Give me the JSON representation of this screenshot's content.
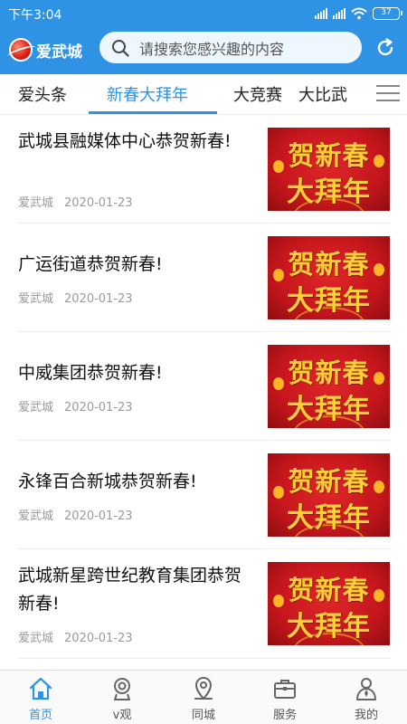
{
  "status": {
    "time": "下午3:04",
    "battery": "37"
  },
  "app": {
    "logo_text": "爱武城"
  },
  "search": {
    "placeholder": "请搜索您感兴趣的内容"
  },
  "tabs": [
    {
      "label": "爱头条"
    },
    {
      "label": "新春大拜年"
    },
    {
      "label": "大竞赛"
    },
    {
      "label": "大比武"
    }
  ],
  "feed": {
    "items": [
      {
        "title": "武城县融媒体中心恭贺新春!",
        "source": "爱武城",
        "date": "2020-01-23",
        "thumb_line1": "贺新春",
        "thumb_line2": "大拜年"
      },
      {
        "title": "广运街道恭贺新春!",
        "source": "爱武城",
        "date": "2020-01-23",
        "thumb_line1": "贺新春",
        "thumb_line2": "大拜年"
      },
      {
        "title": "中威集团恭贺新春!",
        "source": "爱武城",
        "date": "2020-01-23",
        "thumb_line1": "贺新春",
        "thumb_line2": "大拜年"
      },
      {
        "title": "永锋百合新城恭贺新春!",
        "source": "爱武城",
        "date": "2020-01-23",
        "thumb_line1": "贺新春",
        "thumb_line2": "大拜年"
      },
      {
        "title": "武城新星跨世纪教育集团恭贺新春!",
        "source": "爱武城",
        "date": "2020-01-23",
        "thumb_line1": "贺新春",
        "thumb_line2": "大拜年"
      }
    ]
  },
  "bottom_nav": [
    {
      "label": "首页",
      "icon": "home-icon"
    },
    {
      "label": "v观",
      "icon": "camera-icon"
    },
    {
      "label": "同城",
      "icon": "location-pin-icon"
    },
    {
      "label": "服务",
      "icon": "briefcase-icon"
    },
    {
      "label": "我的",
      "icon": "user-icon"
    }
  ],
  "colors": {
    "accent": "#2e93e4",
    "brand_red": "#e2231a",
    "thumb_gold": "#ffcf3a"
  }
}
